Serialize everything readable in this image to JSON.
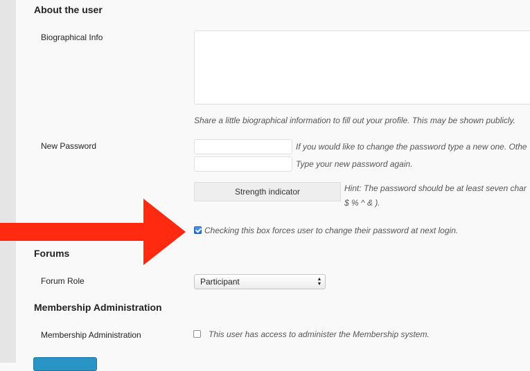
{
  "sections": {
    "about": "About the user",
    "forums": "Forums",
    "membership": "Membership Administration"
  },
  "bio": {
    "label": "Biographical Info",
    "value": "",
    "description": "Share a little biographical information to fill out your profile. This may be shown publicly."
  },
  "password": {
    "label": "New Password",
    "field1_value": "",
    "field2_value": "",
    "hint1": "If you would like to change the password type a new one. Othe",
    "hint2": "Type your new password again.",
    "strength": "Strength indicator",
    "hint_line1": "Hint: The password should be at least seven char",
    "hint_line2": "$ % ^ & ).",
    "force_change": {
      "checked": true,
      "label": "Checking this box forces user to change their password at next login."
    }
  },
  "forum_role": {
    "label": "Forum Role",
    "selected": "Participant"
  },
  "membership_admin": {
    "label": "Membership Administration",
    "checked": false,
    "description": "This user has access to administer the Membership system."
  },
  "colors": {
    "arrow": "#ff2a10",
    "primary_button": "#2a95c5"
  }
}
